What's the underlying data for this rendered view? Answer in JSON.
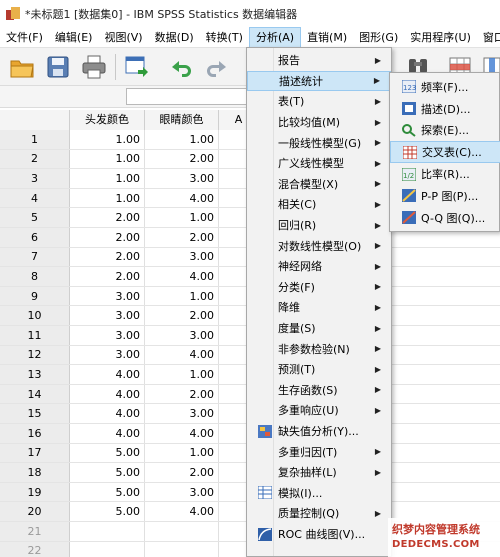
{
  "window": {
    "title": "*未标题1 [数据集0] - IBM SPSS Statistics 数据编辑器"
  },
  "menubar": [
    "文件(F)",
    "编辑(E)",
    "视图(V)",
    "数据(D)",
    "转换(T)",
    "分析(A)",
    "直销(M)",
    "图形(G)",
    "实用程序(U)",
    "窗口("
  ],
  "toolbar": {
    "icons": [
      "open-folder-icon",
      "save-icon",
      "print-icon",
      "recall-dialog-icon",
      "undo-icon",
      "redo-icon",
      "find-icon",
      "insert-cases-icon",
      "insert-variable-icon"
    ]
  },
  "grid": {
    "columns": [
      "头发颜色",
      "眼睛颜色",
      "A"
    ],
    "rows": [
      {
        "n": "1",
        "hair": "1.00",
        "eye": "1.00"
      },
      {
        "n": "2",
        "hair": "1.00",
        "eye": "2.00"
      },
      {
        "n": "3",
        "hair": "1.00",
        "eye": "3.00"
      },
      {
        "n": "4",
        "hair": "1.00",
        "eye": "4.00"
      },
      {
        "n": "5",
        "hair": "2.00",
        "eye": "1.00"
      },
      {
        "n": "6",
        "hair": "2.00",
        "eye": "2.00"
      },
      {
        "n": "7",
        "hair": "2.00",
        "eye": "3.00"
      },
      {
        "n": "8",
        "hair": "2.00",
        "eye": "4.00"
      },
      {
        "n": "9",
        "hair": "3.00",
        "eye": "1.00"
      },
      {
        "n": "10",
        "hair": "3.00",
        "eye": "2.00"
      },
      {
        "n": "11",
        "hair": "3.00",
        "eye": "3.00"
      },
      {
        "n": "12",
        "hair": "3.00",
        "eye": "4.00"
      },
      {
        "n": "13",
        "hair": "4.00",
        "eye": "1.00"
      },
      {
        "n": "14",
        "hair": "4.00",
        "eye": "2.00"
      },
      {
        "n": "15",
        "hair": "4.00",
        "eye": "3.00"
      },
      {
        "n": "16",
        "hair": "4.00",
        "eye": "4.00"
      },
      {
        "n": "17",
        "hair": "5.00",
        "eye": "1.00"
      },
      {
        "n": "18",
        "hair": "5.00",
        "eye": "2.00"
      },
      {
        "n": "19",
        "hair": "5.00",
        "eye": "3.00"
      },
      {
        "n": "20",
        "hair": "5.00",
        "eye": "4.00"
      },
      {
        "n": "21",
        "hair": "",
        "eye": ""
      },
      {
        "n": "22",
        "hair": "",
        "eye": ""
      }
    ]
  },
  "analyze_menu": {
    "items": [
      {
        "label": "报告",
        "arrow": "▶"
      },
      {
        "label": "描述统计",
        "arrow": "▶"
      },
      {
        "label": "表(T)",
        "arrow": "▶"
      },
      {
        "label": "比较均值(M)",
        "arrow": "▶"
      },
      {
        "label": "一般线性模型(G)",
        "arrow": "▶"
      },
      {
        "label": "广义线性模型",
        "arrow": "▶"
      },
      {
        "label": "混合模型(X)",
        "arrow": "▶"
      },
      {
        "label": "相关(C)",
        "arrow": "▶"
      },
      {
        "label": "回归(R)",
        "arrow": "▶"
      },
      {
        "label": "对数线性模型(O)",
        "arrow": "▶"
      },
      {
        "label": "神经网络",
        "arrow": "▶"
      },
      {
        "label": "分类(F)",
        "arrow": "▶"
      },
      {
        "label": "降维",
        "arrow": "▶"
      },
      {
        "label": "度量(S)",
        "arrow": "▶"
      },
      {
        "label": "非参数检验(N)",
        "arrow": "▶"
      },
      {
        "label": "预测(T)",
        "arrow": "▶"
      },
      {
        "label": "生存函数(S)",
        "arrow": "▶"
      },
      {
        "label": "多重响应(U)",
        "arrow": "▶"
      },
      {
        "label": "缺失值分析(Y)...",
        "arrow": ""
      },
      {
        "label": "多重归因(T)",
        "arrow": "▶"
      },
      {
        "label": "复杂抽样(L)",
        "arrow": "▶"
      },
      {
        "label": "模拟(I)...",
        "arrow": ""
      },
      {
        "label": "质量控制(Q)",
        "arrow": "▶"
      },
      {
        "label": "ROC 曲线图(V)...",
        "arrow": ""
      }
    ]
  },
  "descriptive_submenu": {
    "items": [
      {
        "label": "频率(F)..."
      },
      {
        "label": "描述(D)..."
      },
      {
        "label": "探索(E)..."
      },
      {
        "label": "交叉表(C)..."
      },
      {
        "label": "比率(R)..."
      },
      {
        "label": "P-P 图(P)..."
      },
      {
        "label": "Q-Q 图(Q)..."
      }
    ]
  },
  "watermark": {
    "line1": "织梦内容管理系统",
    "line2": "DEDECMS.COM"
  }
}
